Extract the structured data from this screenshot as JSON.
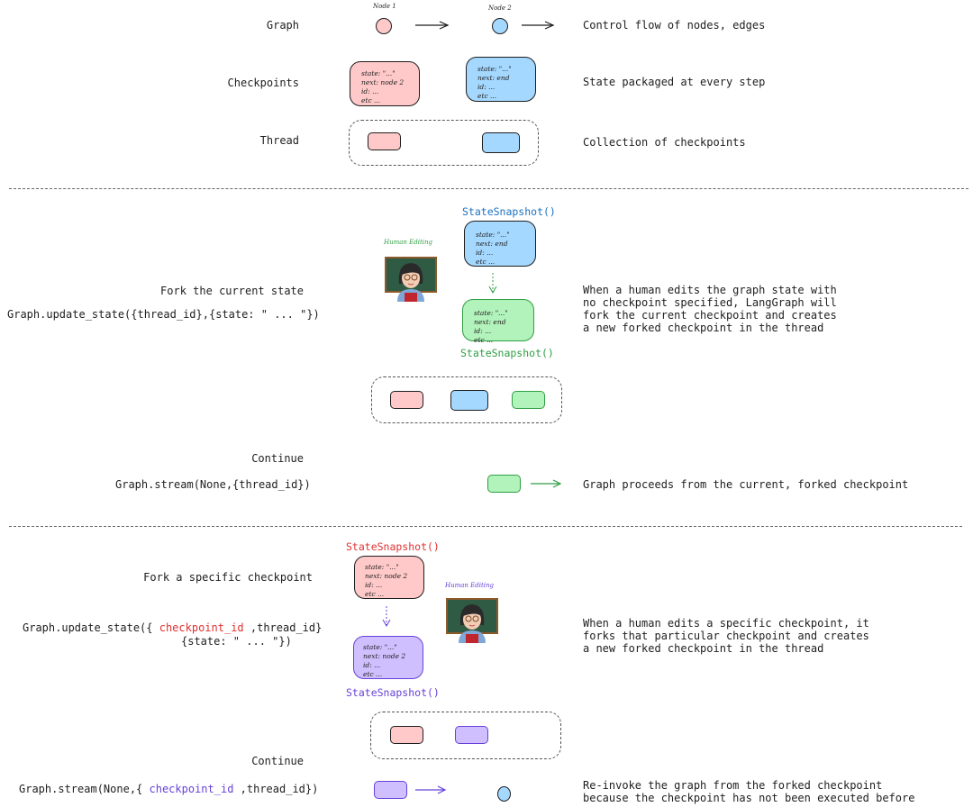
{
  "section1": {
    "rows": [
      {
        "label": "Graph",
        "description": "Control flow of nodes, edges"
      },
      {
        "label": "Checkpoints",
        "description": "State packaged at every step"
      },
      {
        "label": "Thread",
        "description": "Collection of checkpoints"
      }
    ],
    "nodes": [
      {
        "label": "Node 1",
        "color": "#ffc9c9"
      },
      {
        "label": "Node 2",
        "color": "#a5d8ff"
      }
    ],
    "checkpoints": [
      {
        "lines": "state: \"...\"\nnext: node 2\nid: ...\netc ...",
        "color": "#ffc9c9"
      },
      {
        "lines": "state: \"...\"\nnext: end\nid: ...\netc ...",
        "color": "#a5d8ff"
      }
    ]
  },
  "section2": {
    "title": "Fork the current state",
    "code": "Graph.update_state({thread_id},{state: \" ... \"})",
    "description": "When a human edits the graph state with\nno checkpoint specified, LangGraph will\nfork the current checkpoint and creates\na new forked checkpoint in the thread",
    "human_label": "Human Editing",
    "snapshot_top_label": "StateSnapshot()",
    "snapshot_bottom_label": "StateSnapshot()",
    "snapshot_top_lines": "state: \"...\"\nnext: end\nid: ...\netc ...",
    "snapshot_bottom_lines": "state: \"...\"\nnext: end\nid: ...\netc ...",
    "continue_title": "Continue",
    "continue_code": "Graph.stream(None,{thread_id})",
    "continue_description": "Graph proceeds from the current, forked checkpoint",
    "colors": {
      "top_label": "#1971c2",
      "bottom_label": "#2f9e44",
      "human_label": "#2f9e44"
    }
  },
  "section3": {
    "title": "Fork a specific checkpoint",
    "code_prefix": "Graph.update_state({ ",
    "code_highlight": "checkpoint_id",
    "code_suffix": " ,thread_id}",
    "code_line2": "{state: \" ... \"})",
    "description": "When a human edits a specific checkpoint, it\nforks that particular checkpoint and creates\na new forked checkpoint in the thread",
    "human_label": "Human Editing",
    "snapshot_top_label": "StateSnapshot()",
    "snapshot_bottom_label": "StateSnapshot()",
    "snapshot_top_lines": "state: \"...\"\nnext: node 2\nid: ...\netc ...",
    "snapshot_bottom_lines": "state: \"...\"\nnext: node 2\nid: ...\netc ...",
    "continue_title": "Continue",
    "continue_code_prefix": "Graph.stream(None,{ ",
    "continue_code_highlight": "checkpoint_id",
    "continue_code_suffix": " ,thread_id})",
    "continue_description": "Re-invoke the graph from the forked checkpoint\nbecause the checkpoint has not been executed before",
    "colors": {
      "top_label": "#e03131",
      "bottom_label": "#6741d9",
      "human_label": "#6741d9",
      "code_highlight": "#e03131",
      "continue_highlight": "#6741d9"
    }
  }
}
